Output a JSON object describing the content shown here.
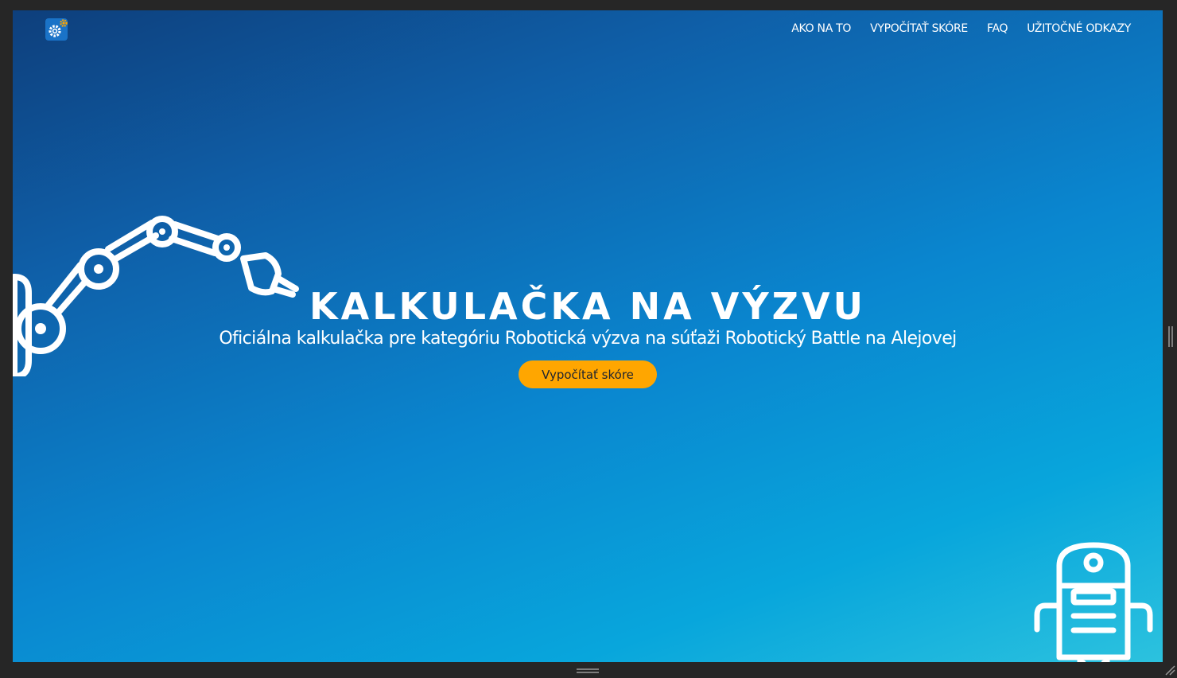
{
  "header": {
    "logo_icon": "gears-icon",
    "nav": [
      {
        "label": "AKO NA TO"
      },
      {
        "label": "VYPOČÍTAŤ SKÓRE"
      },
      {
        "label": "FAQ"
      },
      {
        "label": "UŽITOČNÉ ODKAZY"
      }
    ]
  },
  "hero": {
    "title": "KALKULAČKA NA VÝZVU",
    "subtitle": "Oficiálna kalkulačka pre kategóriu Robotická výzva na súťaži Robotický Battle na Alejovej",
    "cta_label": "Vypočítať skóre"
  },
  "decorations": {
    "left": "robot-arm-icon",
    "bottom_right": "robot-icon"
  },
  "colors": {
    "accent": "#ffa600",
    "gradient_start": "#0e3f7c",
    "gradient_end": "#2cc2de",
    "frame": "#262626"
  }
}
